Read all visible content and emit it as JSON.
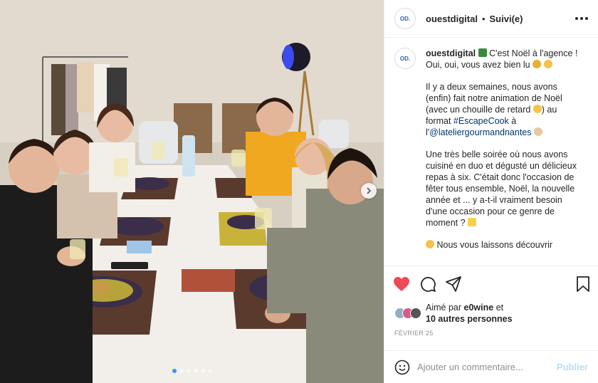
{
  "header": {
    "avatar_text": "OD.",
    "username": "ouestdigital",
    "separator": "•",
    "follow_state": "Suivi(e)"
  },
  "caption": {
    "avatar_text": "OD.",
    "username": "ouestdigital",
    "line1": "C'est Noël à l'agence ! Oui, oui, vous avez bien lu",
    "p2_a": "Il y a deux semaines, nous avons (enfin) fait notre animation de Noël (avec un chouille de retard",
    "p2_b": ") au format",
    "p2_hashtag": "#EscapeCook",
    "p2_c": "à l'",
    "p2_mention": "@lateliergourmandnantes",
    "p3": "Une très belle soirée où nous avons cuisiné en duo et dégusté un délicieux repas à six. C'était donc l'occasion de fêter tous ensemble, Noël, la nouvelle année et ... y a-t-il vraiment besoin d'une occasion pour ce genre de moment ?",
    "p4": "Nous vous laissons découvrir"
  },
  "likes": {
    "prefix": "Aimé par",
    "user": "e0wine",
    "mid": "et",
    "others": "10 autres personnes"
  },
  "date": "FÉVRIER 25",
  "comment": {
    "placeholder": "Ajouter un commentaire...",
    "post_label": "Publier"
  },
  "carousel": {
    "total": 6,
    "active_index": 0
  },
  "colors": {
    "heart": "#ed4956",
    "link": "#00376b",
    "post_disabled": "#b2dffc",
    "dot_active": "#3897f0"
  },
  "icons": {
    "like": "heart-icon",
    "comment": "comment-icon",
    "share": "share-icon",
    "save": "bookmark-icon",
    "emoji": "smiley-icon",
    "more": "more-options-icon",
    "next": "chevron-right-icon"
  }
}
